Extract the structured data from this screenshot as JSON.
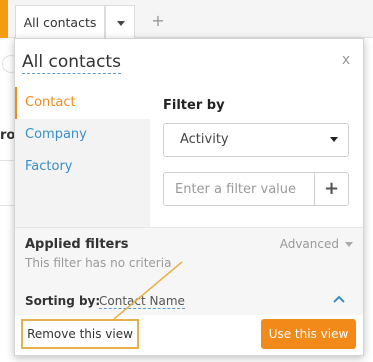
{
  "tabs": {
    "active_label": "All contacts",
    "add_label": "+"
  },
  "background": {
    "ghost_text": "ro"
  },
  "popup": {
    "title": "All contacts",
    "close_label": "x",
    "sidebar": [
      {
        "label": "Contact",
        "active": true
      },
      {
        "label": "Company",
        "active": false
      },
      {
        "label": "Factory",
        "active": false
      }
    ],
    "filter_by": {
      "heading": "Filter by",
      "selected": "Activity",
      "input_placeholder": "Enter a filter value",
      "input_value": "",
      "add_label": "+"
    },
    "applied_filters": {
      "title": "Applied filters",
      "empty_text": "This filter has no criteria",
      "advanced_label": "Advanced"
    },
    "sorting": {
      "label": "Sorting by:",
      "value": "Contact Name"
    },
    "buttons": {
      "remove": "Remove this view",
      "use": "Use this view"
    }
  },
  "colors": {
    "accent_orange": "#f28a1a",
    "link_blue": "#3a8fc8",
    "highlight_border": "#e8b04a"
  },
  "icons": {
    "tab_dropdown": "chevron-down-icon",
    "close": "close-icon",
    "add_filter": "plus-icon",
    "advanced": "caret-down-icon",
    "sort_toggle": "chevron-up-icon"
  }
}
